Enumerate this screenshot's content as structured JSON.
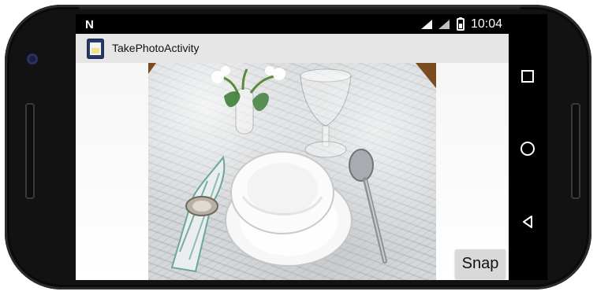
{
  "status_bar": {
    "notification_letter": "N",
    "time": "10:04",
    "icons": [
      "wifi-icon",
      "signal-icon",
      "battery-icon"
    ]
  },
  "app_bar": {
    "title": "TakePhotoActivity",
    "icon": "app-icon"
  },
  "main": {
    "photo_alt": "Table setting photo",
    "snap_label": "Snap"
  },
  "nav_bar": {
    "icons": [
      "recents-icon",
      "home-icon",
      "back-icon"
    ]
  },
  "colors": {
    "device_bezel": "#121212",
    "screen_bg": "#000000",
    "app_bar_bg": "#e6e6e6",
    "button_bg": "#d9d9d9"
  }
}
